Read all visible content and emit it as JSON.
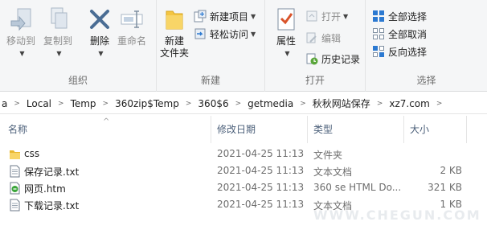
{
  "ribbon": {
    "organize": {
      "label": "组织",
      "move_to": "移动到",
      "copy_to": "复制到",
      "delete": "删除",
      "rename": "重命名"
    },
    "new": {
      "label": "新建",
      "new_folder_line1": "新建",
      "new_folder_line2": "文件夹",
      "new_item": "新建项目",
      "easy_access": "轻松访问"
    },
    "open": {
      "label": "打开",
      "properties": "属性",
      "open": "打开",
      "edit": "编辑",
      "history": "历史记录"
    },
    "select": {
      "label": "选择",
      "select_all": "全部选择",
      "select_none": "全部取消",
      "invert": "反向选择"
    }
  },
  "address": {
    "crumbs": [
      "a",
      "Local",
      "Temp",
      "360zip$Temp",
      "360$6",
      "getmedia",
      "秋秋网站保存",
      "xz7.com"
    ]
  },
  "columns": {
    "name": "名称",
    "date": "修改日期",
    "type": "类型",
    "size": "大小"
  },
  "files": [
    {
      "name": "css",
      "date": "2021-04-25 11:13",
      "type": "文件夹",
      "size": "",
      "icon": "folder-icon"
    },
    {
      "name": "保存记录.txt",
      "date": "2021-04-25 11:13",
      "type": "文本文档",
      "size": "2 KB",
      "icon": "text-file-icon"
    },
    {
      "name": "网页.htm",
      "date": "2021-04-25 11:13",
      "type": "360 se HTML Do...",
      "size": "321 KB",
      "icon": "html-file-icon"
    },
    {
      "name": "下载记录.txt",
      "date": "2021-04-25 11:13",
      "type": "文本文档",
      "size": "1 KB",
      "icon": "text-file-icon"
    }
  ],
  "watermark": "WWW.CHEGUN.COM",
  "colors": {
    "folder": "#f4c542",
    "accent": "#2b79d1",
    "check_red": "#d9542b"
  }
}
